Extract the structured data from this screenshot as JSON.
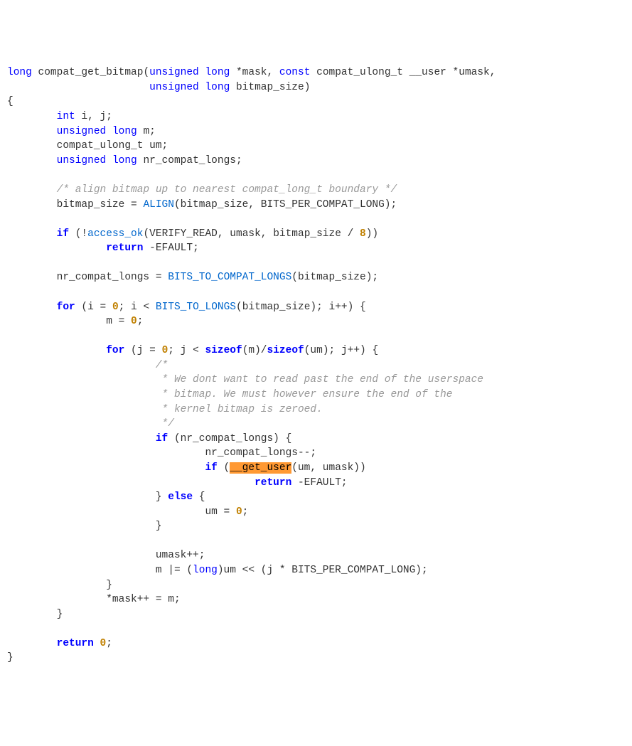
{
  "code": {
    "sig1a": "long",
    "sig1b": " compat_get_bitmap(",
    "sig1c": "unsigned",
    "sig1d": " ",
    "sig1e": "long",
    "sig1f": " *mask, ",
    "sig1g": "const",
    "sig1h": " compat_ulong_t __user *umask,",
    "sig2a": "                       ",
    "sig2b": "unsigned",
    "sig2c": " ",
    "sig2d": "long",
    "sig2e": " bitmap_size)",
    "l3": "{",
    "l4a": "        ",
    "l4b": "int",
    "l4c": " i, j;",
    "l5a": "        ",
    "l5b": "unsigned",
    "l5c": " ",
    "l5d": "long",
    "l5e": " m;",
    "l6": "        compat_ulong_t um;",
    "l7a": "        ",
    "l7b": "unsigned",
    "l7c": " ",
    "l7d": "long",
    "l7e": " nr_compat_longs;",
    "l9": "        /* align bitmap up to nearest compat_long_t boundary */",
    "l10a": "        bitmap_size = ",
    "l10b": "ALIGN",
    "l10c": "(bitmap_size, BITS_PER_COMPAT_LONG);",
    "l12a": "        ",
    "l12b": "if",
    "l12c": " (!",
    "l12d": "access_ok",
    "l12e": "(VERIFY_READ, umask, bitmap_size / ",
    "l12f": "8",
    "l12g": "))",
    "l13a": "                ",
    "l13b": "return",
    "l13c": " -EFAULT;",
    "l15a": "        nr_compat_longs = ",
    "l15b": "BITS_TO_COMPAT_LONGS",
    "l15c": "(bitmap_size);",
    "l17a": "        ",
    "l17b": "for",
    "l17c": " (i = ",
    "l17d": "0",
    "l17e": "; i < ",
    "l17f": "BITS_TO_LONGS",
    "l17g": "(bitmap_size); i++) {",
    "l18a": "                m = ",
    "l18b": "0",
    "l18c": ";",
    "l20a": "                ",
    "l20b": "for",
    "l20c": " (j = ",
    "l20d": "0",
    "l20e": "; j < ",
    "l20f": "sizeof",
    "l20g": "(m)/",
    "l20h": "sizeof",
    "l20i": "(um); j++) {",
    "l21": "                        /*",
    "l22": "                         * We dont want to read past the end of the userspace",
    "l23": "                         * bitmap. We must however ensure the end of the",
    "l24": "                         * kernel bitmap is zeroed.",
    "l25": "                         */",
    "l26a": "                        ",
    "l26b": "if",
    "l26c": " (nr_compat_longs) {",
    "l27": "                                nr_compat_longs--;",
    "l28a": "                                ",
    "l28b": "if",
    "l28c": " (",
    "l28d": "__get_user",
    "l28e": "(um, umask))",
    "l29a": "                                        ",
    "l29b": "return",
    "l29c": " -EFAULT;",
    "l30a": "                        } ",
    "l30b": "else",
    "l30c": " {",
    "l31a": "                                um = ",
    "l31b": "0",
    "l31c": ";",
    "l32": "                        }",
    "l34": "                        umask++;",
    "l35a": "                        m |= (",
    "l35b": "long",
    "l35c": ")um << (j * BITS_PER_COMPAT_LONG);",
    "l36": "                }",
    "l37": "                *mask++ = m;",
    "l38": "        }",
    "l40a": "        ",
    "l40b": "return",
    "l40c": " ",
    "l40d": "0",
    "l40e": ";",
    "l41": "}"
  }
}
